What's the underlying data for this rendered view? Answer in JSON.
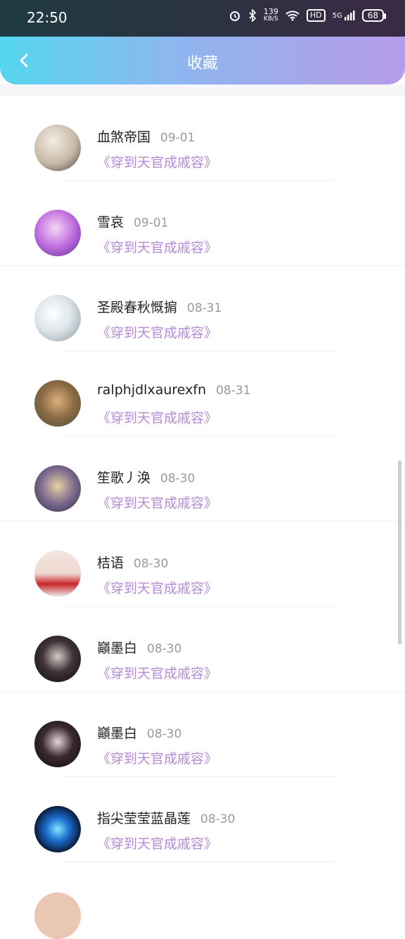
{
  "status": {
    "time": "22:50",
    "speed_value": "139",
    "speed_unit": "KB/S",
    "hd": "HD",
    "network": "5G",
    "battery": "68"
  },
  "header": {
    "title": "收藏"
  },
  "items": [
    {
      "name": "血煞帝国",
      "date": "09-01",
      "book": "《穿到天官成戚容》"
    },
    {
      "name": "雪哀",
      "date": "09-01",
      "book": "《穿到天官成戚容》"
    },
    {
      "name": "圣殿春秋慨掮",
      "date": "08-31",
      "book": "《穿到天官成戚容》"
    },
    {
      "name": "ralphjdlxaurexfn",
      "date": "08-31",
      "book": "《穿到天官成戚容》"
    },
    {
      "name": "笙歌丿涣",
      "date": "08-30",
      "book": "《穿到天官成戚容》"
    },
    {
      "name": "桔语",
      "date": "08-30",
      "book": "《穿到天官成戚容》"
    },
    {
      "name": "巓墨白",
      "date": "08-30",
      "book": "《穿到天官成戚容》"
    },
    {
      "name": "巓墨白",
      "date": "08-30",
      "book": "《穿到天官成戚容》"
    },
    {
      "name": "指尖莹莹蓝晶莲",
      "date": "08-30",
      "book": "《穿到天官成戚容》"
    }
  ],
  "colors": {
    "accent_book": "#b58ad6",
    "header_start": "#55d6ef",
    "header_end": "#b69be8"
  }
}
